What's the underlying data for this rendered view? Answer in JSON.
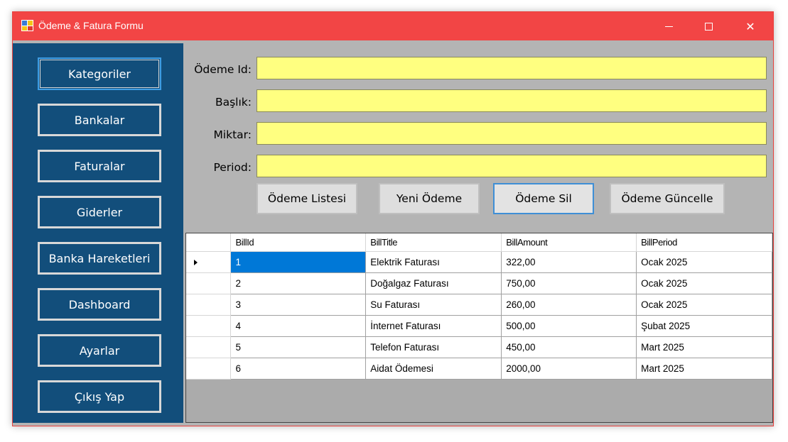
{
  "window": {
    "title": "Ödeme & Fatura Formu"
  },
  "sidebar": {
    "items": [
      {
        "label": "Kategoriler"
      },
      {
        "label": "Bankalar"
      },
      {
        "label": "Faturalar"
      },
      {
        "label": "Giderler"
      },
      {
        "label": "Banka Hareketleri"
      },
      {
        "label": "Dashboard"
      },
      {
        "label": "Ayarlar"
      },
      {
        "label": "Çıkış Yap"
      }
    ]
  },
  "form": {
    "fields": [
      {
        "label": "Ödeme Id:",
        "value": ""
      },
      {
        "label": "Başlık:",
        "value": ""
      },
      {
        "label": "Miktar:",
        "value": ""
      },
      {
        "label": "Period:",
        "value": ""
      }
    ],
    "buttons": [
      {
        "label": "Ödeme Listesi"
      },
      {
        "label": "Yeni Ödeme"
      },
      {
        "label": "Ödeme Sil"
      },
      {
        "label": "Ödeme Güncelle"
      }
    ]
  },
  "grid": {
    "columns": [
      "BillId",
      "BillTitle",
      "BillAmount",
      "BillPeriod"
    ],
    "rows": [
      [
        "1",
        "Elektrik Faturası",
        "322,00",
        "Ocak 2025"
      ],
      [
        "2",
        "Doğalgaz Faturası",
        "750,00",
        "Ocak 2025"
      ],
      [
        "3",
        "Su Faturası",
        "260,00",
        "Ocak 2025"
      ],
      [
        "4",
        "İnternet Faturası",
        "500,00",
        "Şubat 2025"
      ],
      [
        "5",
        "Telefon Faturası",
        "450,00",
        "Mart 2025"
      ],
      [
        "6",
        "Aidat Ödemesi",
        "2000,00",
        "Mart 2025"
      ]
    ],
    "selected_row": 0
  },
  "colors": {
    "titlebar": "#f24545",
    "sidebar": "#124e7b",
    "input_background": "#ffff80",
    "selection": "#0078d7"
  }
}
